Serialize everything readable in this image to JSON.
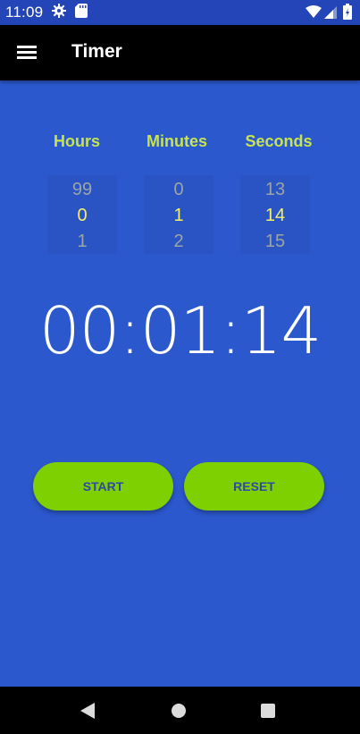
{
  "status_bar": {
    "time": "11:09",
    "icons": [
      "gear-icon",
      "sd-card-icon",
      "wifi-icon",
      "signal-icon",
      "battery-icon"
    ]
  },
  "app_bar": {
    "title": "Timer",
    "menu_icon": "hamburger-menu-icon"
  },
  "pickers": {
    "hours": {
      "label": "Hours",
      "prev": "99",
      "current": "0",
      "next": "1"
    },
    "minutes": {
      "label": "Minutes",
      "prev": "0",
      "current": "1",
      "next": "2"
    },
    "seconds": {
      "label": "Seconds",
      "prev": "13",
      "current": "14",
      "next": "15"
    }
  },
  "display": {
    "time": "00:01:14"
  },
  "buttons": {
    "start_label": "START",
    "reset_label": "RESET"
  },
  "nav_bar": {
    "icons": [
      "back-icon",
      "home-icon",
      "recents-icon"
    ]
  },
  "colors": {
    "background": "#2b58cc",
    "status_bar": "#2345b7",
    "app_bar": "#000000",
    "label_accent": "#c7e34f",
    "picker_selected": "#f3f16a",
    "picker_unselected": "#9ba5a6",
    "button": "#7ed000",
    "button_text": "#2f47a8"
  }
}
